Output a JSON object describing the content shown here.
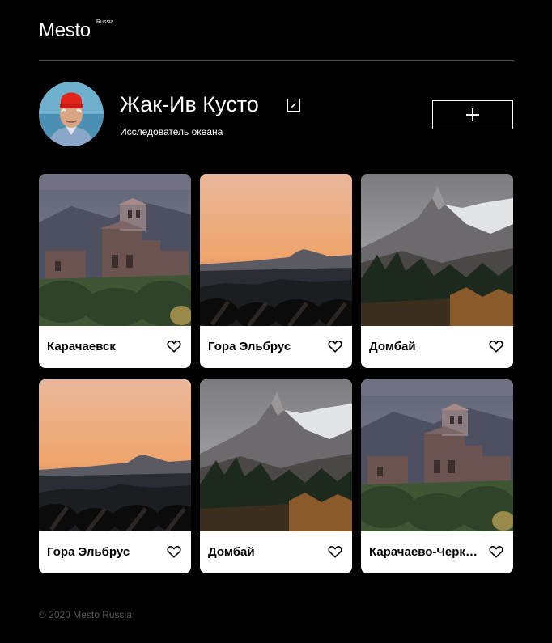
{
  "header": {
    "logo": "Mesto",
    "logo_sub": "Russia"
  },
  "profile": {
    "name": "Жак-Ив Кусто",
    "about": "Исследователь океана",
    "add_label": "+"
  },
  "cards": [
    {
      "title": "Карачаевск",
      "image": "church"
    },
    {
      "title": "Гора Эльбрус",
      "image": "sunset"
    },
    {
      "title": "Домбай",
      "image": "mountain"
    },
    {
      "title": "Гора Эльбрус",
      "image": "sunset"
    },
    {
      "title": "Домбай",
      "image": "mountain"
    },
    {
      "title": "Карачаево-Черкесия",
      "image": "church"
    }
  ],
  "footer": {
    "copyright": "© 2020 Mesto Russia"
  },
  "icons": {
    "edit": "pencil-icon",
    "add": "plus-icon",
    "like": "heart-outline-icon"
  }
}
